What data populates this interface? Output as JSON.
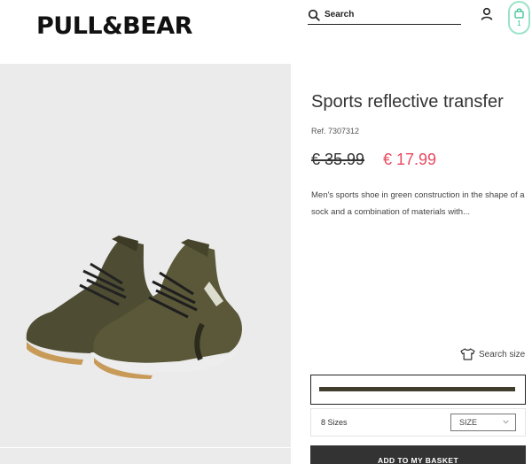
{
  "header": {
    "logo_text": "PULL&BEAR",
    "search": {
      "placeholder": "Search",
      "icon": "search-icon"
    },
    "user_icon": "user-icon",
    "basket": {
      "icon": "basket-icon",
      "count": "1",
      "accent_color": "#9be3c8"
    }
  },
  "product": {
    "image_icon": "sneakers-image",
    "title": "Sports reflective transfer",
    "ref": "Ref. 7307312",
    "old_price": "€ 35.99",
    "new_price": "€ 17.99",
    "sale_color": "#e8495f",
    "description": "Men's sports shoe in green construction in the shape of a sock and a combination of materials with...",
    "size_guide_label": "Search size",
    "selected_color": "#403d2c",
    "sizes_count_label": "8 Sizes",
    "size_select_value": "SIZE",
    "add_button_label": "ADD TO MY BASKET"
  }
}
